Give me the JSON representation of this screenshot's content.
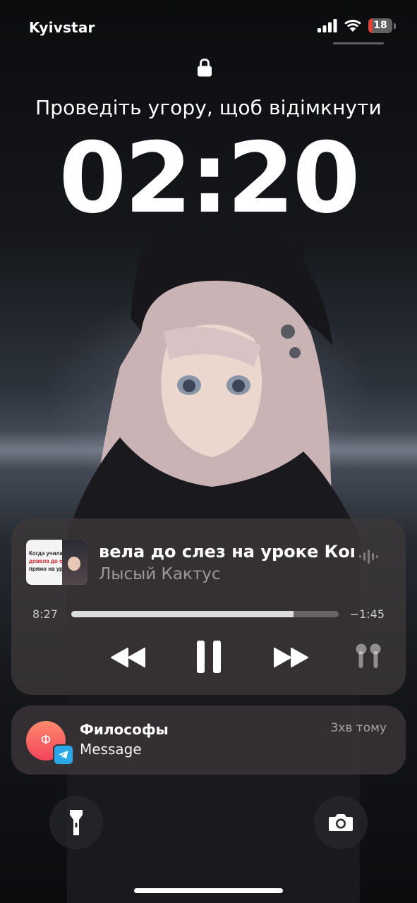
{
  "status_bar": {
    "carrier": "Kyivstar",
    "battery_level": "18",
    "battery_fraction": 0.18,
    "battery_color": "#e0433a"
  },
  "lock_screen": {
    "unlock_hint": "Проведіть угору, щоб відімкнути",
    "time": "02:20"
  },
  "now_playing": {
    "artwork_lines": [
      "Когда училка",
      "довела до слез",
      "прямо на уроке"
    ],
    "title_scroll": "вела до слез на уроке     Ког",
    "artist": "Лысый Кактус",
    "elapsed": "8:27",
    "remaining": "−1:45",
    "progress_fraction": 0.83,
    "controls": {
      "previous": "backward-icon",
      "play_pause": "pause-icon",
      "next": "forward-icon",
      "output": "airpods-icon"
    }
  },
  "notification": {
    "avatar_letter": "Ф",
    "app_icon": "telegram-icon",
    "title": "Философы",
    "body": "Message",
    "time": "3хв тому"
  },
  "quick_actions": {
    "left": "flashlight-icon",
    "right": "camera-icon"
  }
}
